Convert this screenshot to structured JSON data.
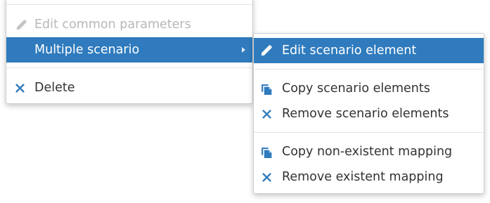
{
  "main_menu": {
    "items": [
      {
        "label": "Edit common parameters",
        "icon": "pencil-icon",
        "state": "disabled"
      },
      {
        "label": "Multiple scenario",
        "icon": "",
        "state": "active-submenu"
      },
      {
        "label": "Delete",
        "icon": "x-icon",
        "state": "normal"
      }
    ]
  },
  "sub_menu": {
    "items": [
      {
        "label": "Edit scenario element",
        "icon": "pencil-icon",
        "state": "highlighted"
      },
      {
        "label": "Copy scenario elements",
        "icon": "copy-icon",
        "state": "normal"
      },
      {
        "label": "Remove scenario elements",
        "icon": "x-icon",
        "state": "normal"
      },
      {
        "label": "Copy non-existent mapping",
        "icon": "copy-icon",
        "state": "normal"
      },
      {
        "label": "Remove existent mapping",
        "icon": "x-icon",
        "state": "normal"
      }
    ]
  },
  "colors": {
    "highlight": "#2f7bbd",
    "icon": "#2f7bbd",
    "text": "#333333",
    "disabled": "#b8b8b8"
  }
}
